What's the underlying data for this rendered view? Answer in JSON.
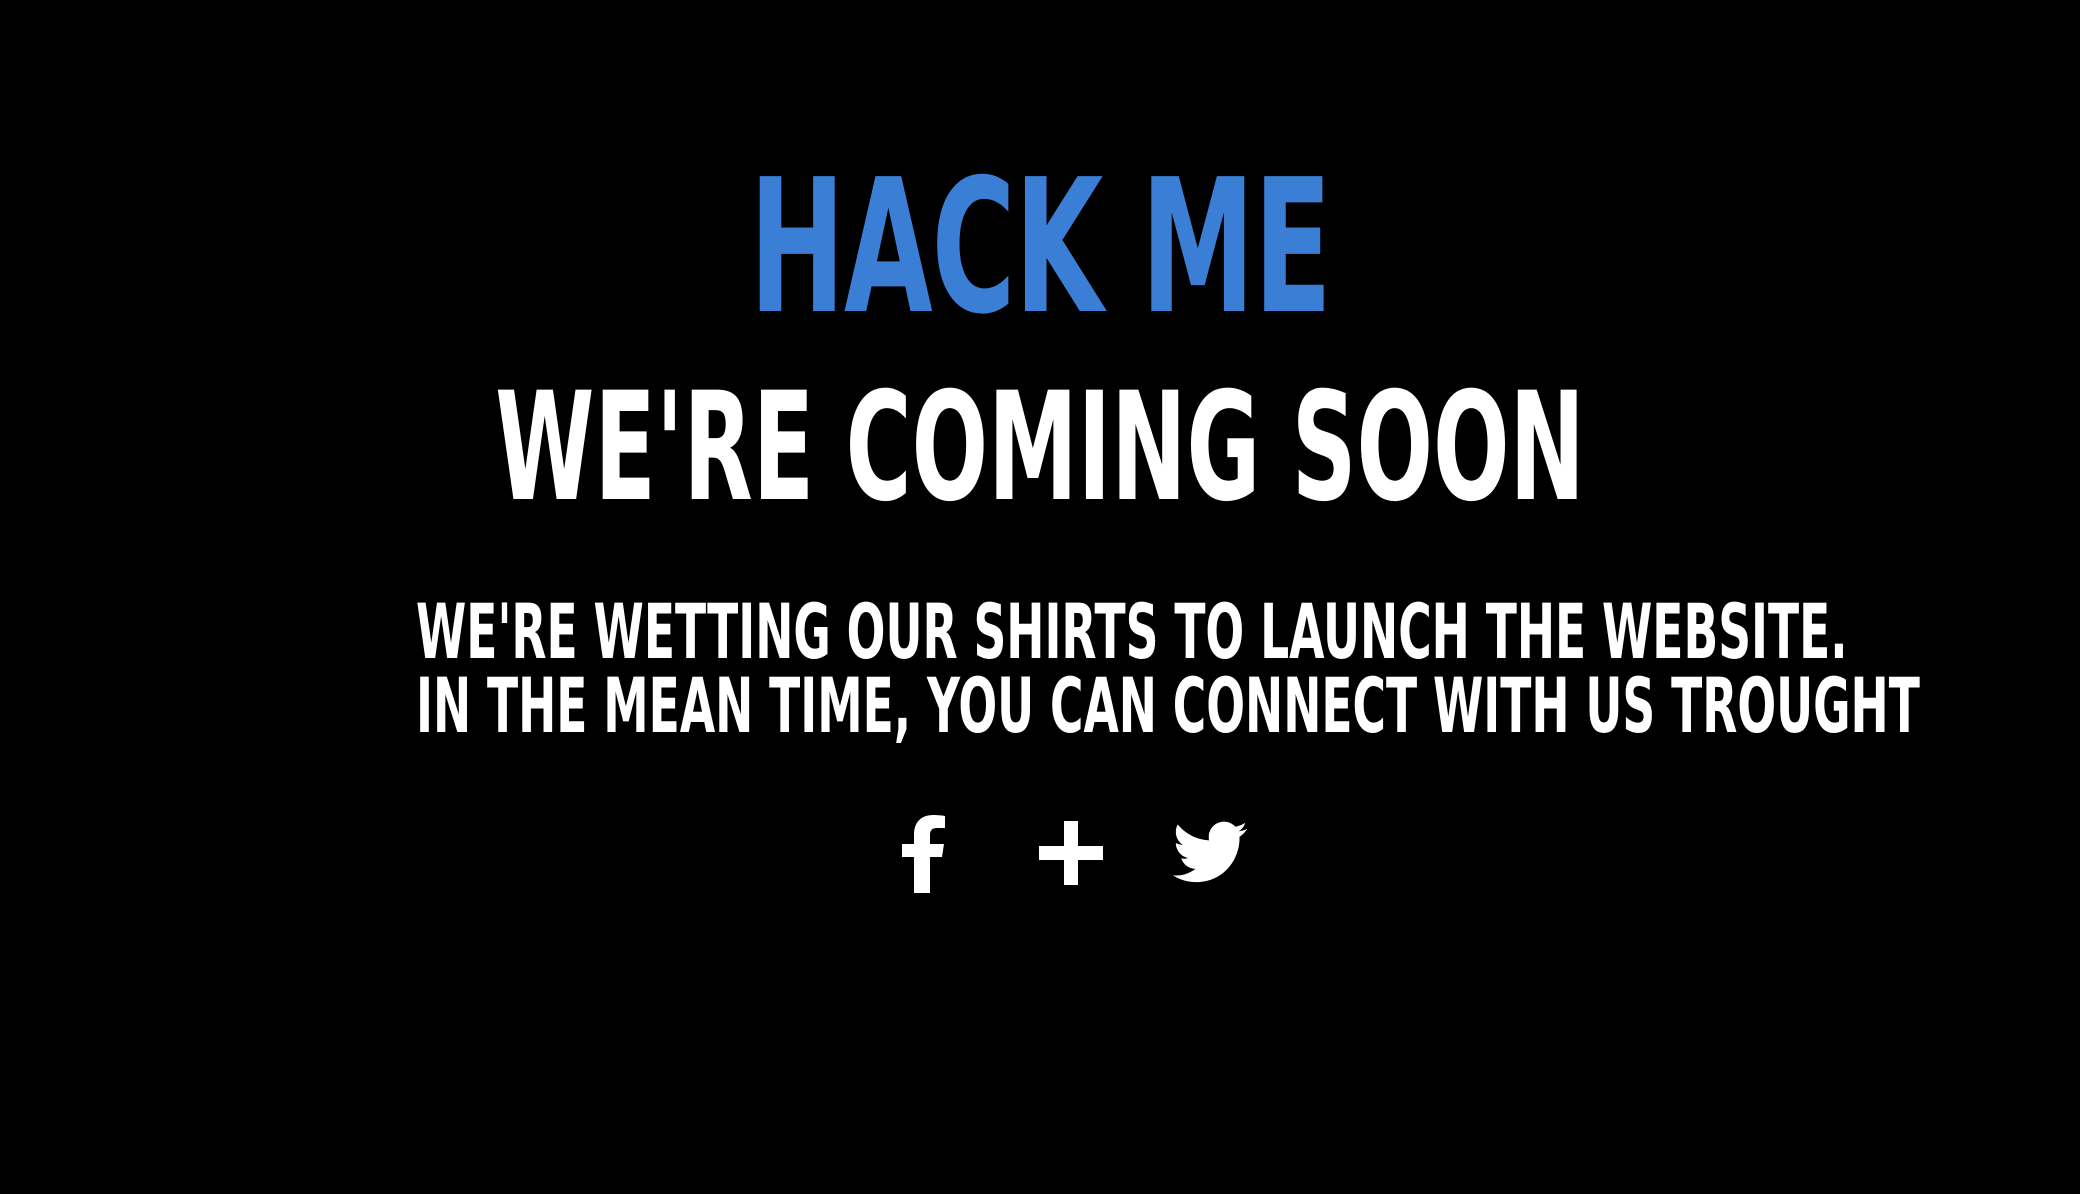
{
  "brand": {
    "title": "HACK ME",
    "color": "#3a7fd5"
  },
  "hero": {
    "headline": "WE'RE COMING SOON",
    "message_line_1": "WE'RE WETTING OUR SHIRTS TO LAUNCH THE WEBSITE.",
    "message_line_2": "IN THE MEAN TIME, YOU CAN CONNECT WITH US TROUGHT"
  },
  "social": {
    "items": [
      {
        "icon": "facebook-icon"
      },
      {
        "icon": "google-plus-icon"
      },
      {
        "icon": "twitter-icon"
      }
    ]
  },
  "colors": {
    "background": "#000000",
    "text": "#ffffff"
  }
}
